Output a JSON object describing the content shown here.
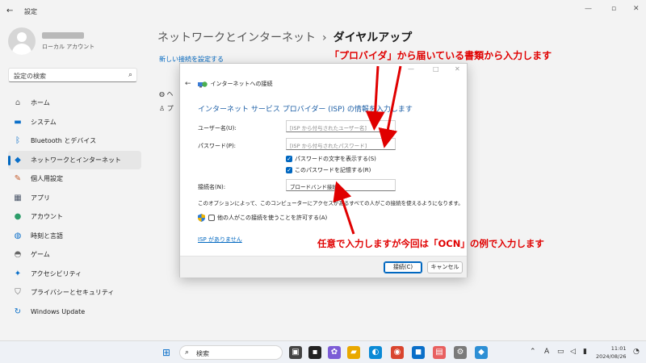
{
  "app": {
    "title": "設定",
    "account_label": "ローカル アカウント"
  },
  "sidebar": {
    "search_placeholder": "設定の検索",
    "items": [
      {
        "label": "ホーム",
        "icon": "home-icon"
      },
      {
        "label": "システム",
        "icon": "monitor-icon"
      },
      {
        "label": "Bluetooth とデバイス",
        "icon": "bluetooth-icon"
      },
      {
        "label": "ネットワークとインターネット",
        "icon": "wifi-icon",
        "active": true
      },
      {
        "label": "個人用設定",
        "icon": "brush-icon"
      },
      {
        "label": "アプリ",
        "icon": "apps-icon"
      },
      {
        "label": "アカウント",
        "icon": "person-icon"
      },
      {
        "label": "時刻と言語",
        "icon": "globe-icon"
      },
      {
        "label": "ゲーム",
        "icon": "gamepad-icon"
      },
      {
        "label": "アクセシビリティ",
        "icon": "accessibility-icon"
      },
      {
        "label": "プライバシーとセキュリティ",
        "icon": "shield-icon"
      },
      {
        "label": "Windows Update",
        "icon": "update-icon"
      }
    ]
  },
  "main": {
    "breadcrumb_parent": "ネットワークとインターネット",
    "breadcrumb_sep": "›",
    "breadcrumb_current": "ダイヤルアップ",
    "new_connection_link": "新しい接続を設定する",
    "bg_row1": "ヘ",
    "bg_row2": "プ"
  },
  "dialog": {
    "title": "インターネットへの接続",
    "heading": "インターネット サービス プロバイダー (ISP) の情報を入力します",
    "username_label": "ユーザー名(U):",
    "username_placeholder": "[ISP から付与されたユーザー名]",
    "password_label": "パスワード(P):",
    "password_placeholder": "[ISP から付与されたパスワード]",
    "show_password": "パスワードの文字を表示する(S)",
    "remember_password": "このパスワードを記憶する(R)",
    "conn_name_label": "接続名(N):",
    "conn_name_value": "ブロードバンド接続",
    "note": "このオプションによって、このコンピューターにアクセスがあるすべての人がこの接続を使えるようになります。",
    "allow_others": "他の人がこの接続を使うことを許可する(A)",
    "no_isp_link": "ISP がありません",
    "connect_button": "接続(C)",
    "cancel_button": "キャンセル"
  },
  "annotations": {
    "top": "「プロバイダ」から届いている書類から入力します",
    "bottom": "任意で入力しますが今回は「OCN」の例で入力します",
    "color": "#e00000"
  },
  "taskbar": {
    "search_label": "検索",
    "tray_lang": "A",
    "time": "11:01",
    "date": "2024/08/26"
  }
}
